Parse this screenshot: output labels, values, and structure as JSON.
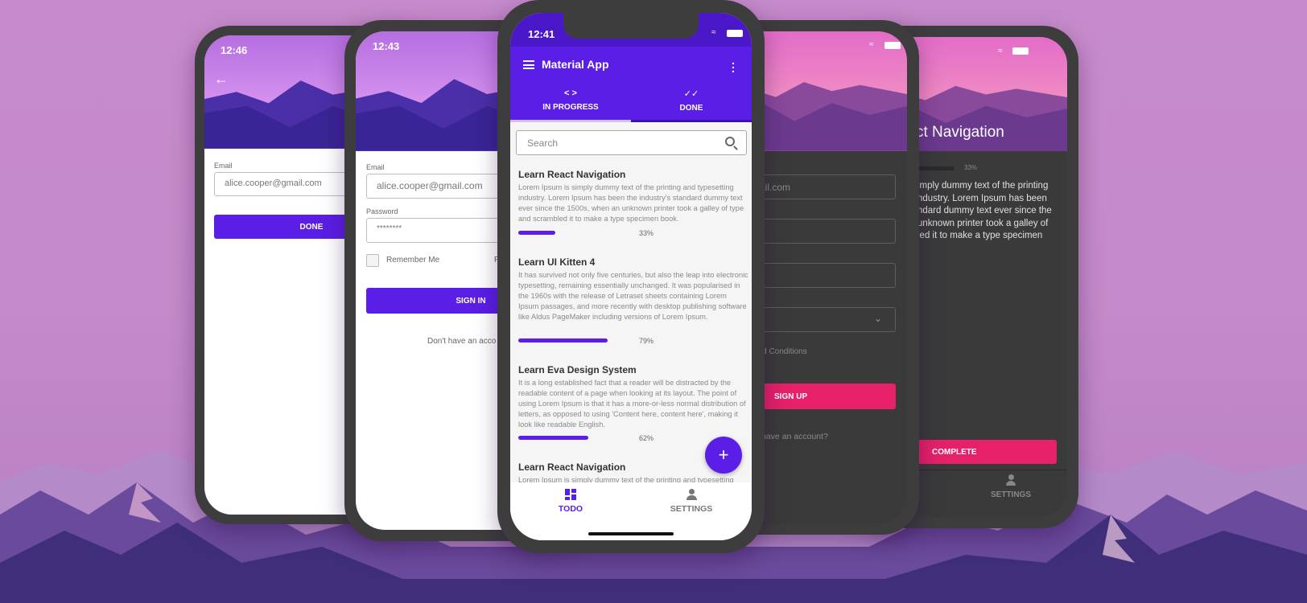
{
  "colors": {
    "primary": "#5b1ee6",
    "primary_dark": "#4a17c9",
    "accent": "#e6216a",
    "dark_bg": "#3a3a3a"
  },
  "phone_back_left": {
    "time": "12:46",
    "back_icon": "arrow-left-icon",
    "email_label": "Email",
    "email_value": "alice.cooper@gmail.com",
    "done_label": "DONE"
  },
  "phone_login": {
    "time": "12:43",
    "email_label": "Email",
    "email_value": "alice.cooper@gmail.com",
    "password_label": "Password",
    "password_value": "********",
    "remember_label": "Remember Me",
    "forgot_fragment": "F",
    "sign_in_label": "SIGN IN",
    "signup_prompt": "Don't have an acco"
  },
  "phone_main": {
    "time": "12:41",
    "app_title": "Material App",
    "tabs": [
      {
        "label": "IN PROGRESS",
        "icon": "code-icon",
        "active": true
      },
      {
        "label": "DONE",
        "icon": "done-all-icon",
        "active": false
      }
    ],
    "search_placeholder": "Search",
    "cards": [
      {
        "title": "Learn React Navigation",
        "body": "Lorem Ipsum is simply dummy text of the printing and typesetting industry. Lorem Ipsum has been the industry's standard dummy text ever since the 1500s, when an unknown printer took a galley of type and scrambled it to make a type specimen book.",
        "progress": 33,
        "progress_label": "33%"
      },
      {
        "title": "Learn UI Kitten 4",
        "body": "It has survived not only five centuries, but also the leap into electronic typesetting, remaining essentially unchanged. It was popularised in the 1960s with the release of Letraset sheets containing Lorem Ipsum passages, and more recently with desktop publishing software like Aldus PageMaker including versions of Lorem Ipsum.",
        "progress": 79,
        "progress_label": "79%"
      },
      {
        "title": "Learn Eva Design System",
        "body": "It is a long established fact that a reader will be distracted by the readable content of a page when looking at its layout. The point of using Lorem Ipsum is that it has a more-or-less normal distribution of letters, as opposed to using 'Content here, content here', making it look like readable English.",
        "progress": 62,
        "progress_label": "62%"
      },
      {
        "title": "Learn React Navigation",
        "body": "Lorem Ipsum is simply dummy text of the printing and typesetting"
      }
    ],
    "fab_label": "+",
    "bottom_nav": [
      {
        "label": "TODO",
        "icon": "dashboard-icon",
        "active": true
      },
      {
        "label": "SETTINGS",
        "icon": "person-icon",
        "active": false
      }
    ]
  },
  "phone_signup": {
    "email_fragment": "ail.com",
    "terms_fragment": "and Conditions",
    "sign_up_label": "SIGN UP",
    "login_prompt_fragment": "dy have an account?"
  },
  "phone_detail": {
    "title_fragment": "ct Navigation",
    "progress": 33,
    "progress_label": "33%",
    "body_lines": [
      "imply dummy text of the printing",
      "ndustry. Lorem Ipsum has been",
      "ndard dummy text ever since the",
      "unknown printer took a galley of",
      "led it to make a type specimen"
    ],
    "complete_label": "COMPLETE",
    "nav_settings": "SETTINGS"
  }
}
